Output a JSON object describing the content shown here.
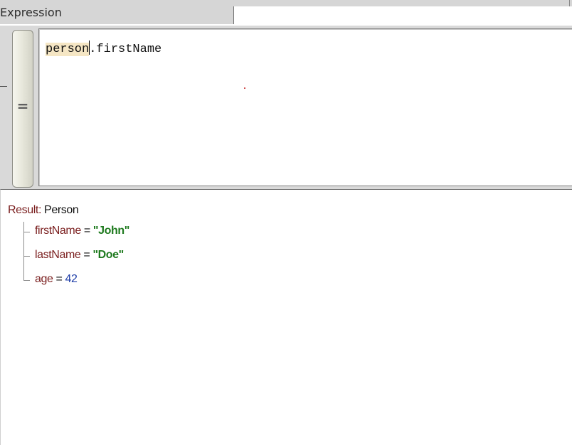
{
  "tab": {
    "label": "Expression"
  },
  "editor": {
    "eq_button_label": "=",
    "tokens": {
      "object": "person",
      "member": ".firstName"
    }
  },
  "result": {
    "label": "Result:",
    "type": "Person",
    "fields": [
      {
        "name": "firstName",
        "eq": " = ",
        "value": "\"John\"",
        "kind": "string"
      },
      {
        "name": "lastName",
        "eq": " = ",
        "value": "\"Doe\"",
        "kind": "string"
      },
      {
        "name": "age",
        "eq": " = ",
        "value": "42",
        "kind": "number"
      }
    ]
  },
  "colors": {
    "key": "#7a1e1e",
    "string": "#1e7a1e",
    "number": "#1f3ea8",
    "highlight": "#f5e6c4"
  }
}
